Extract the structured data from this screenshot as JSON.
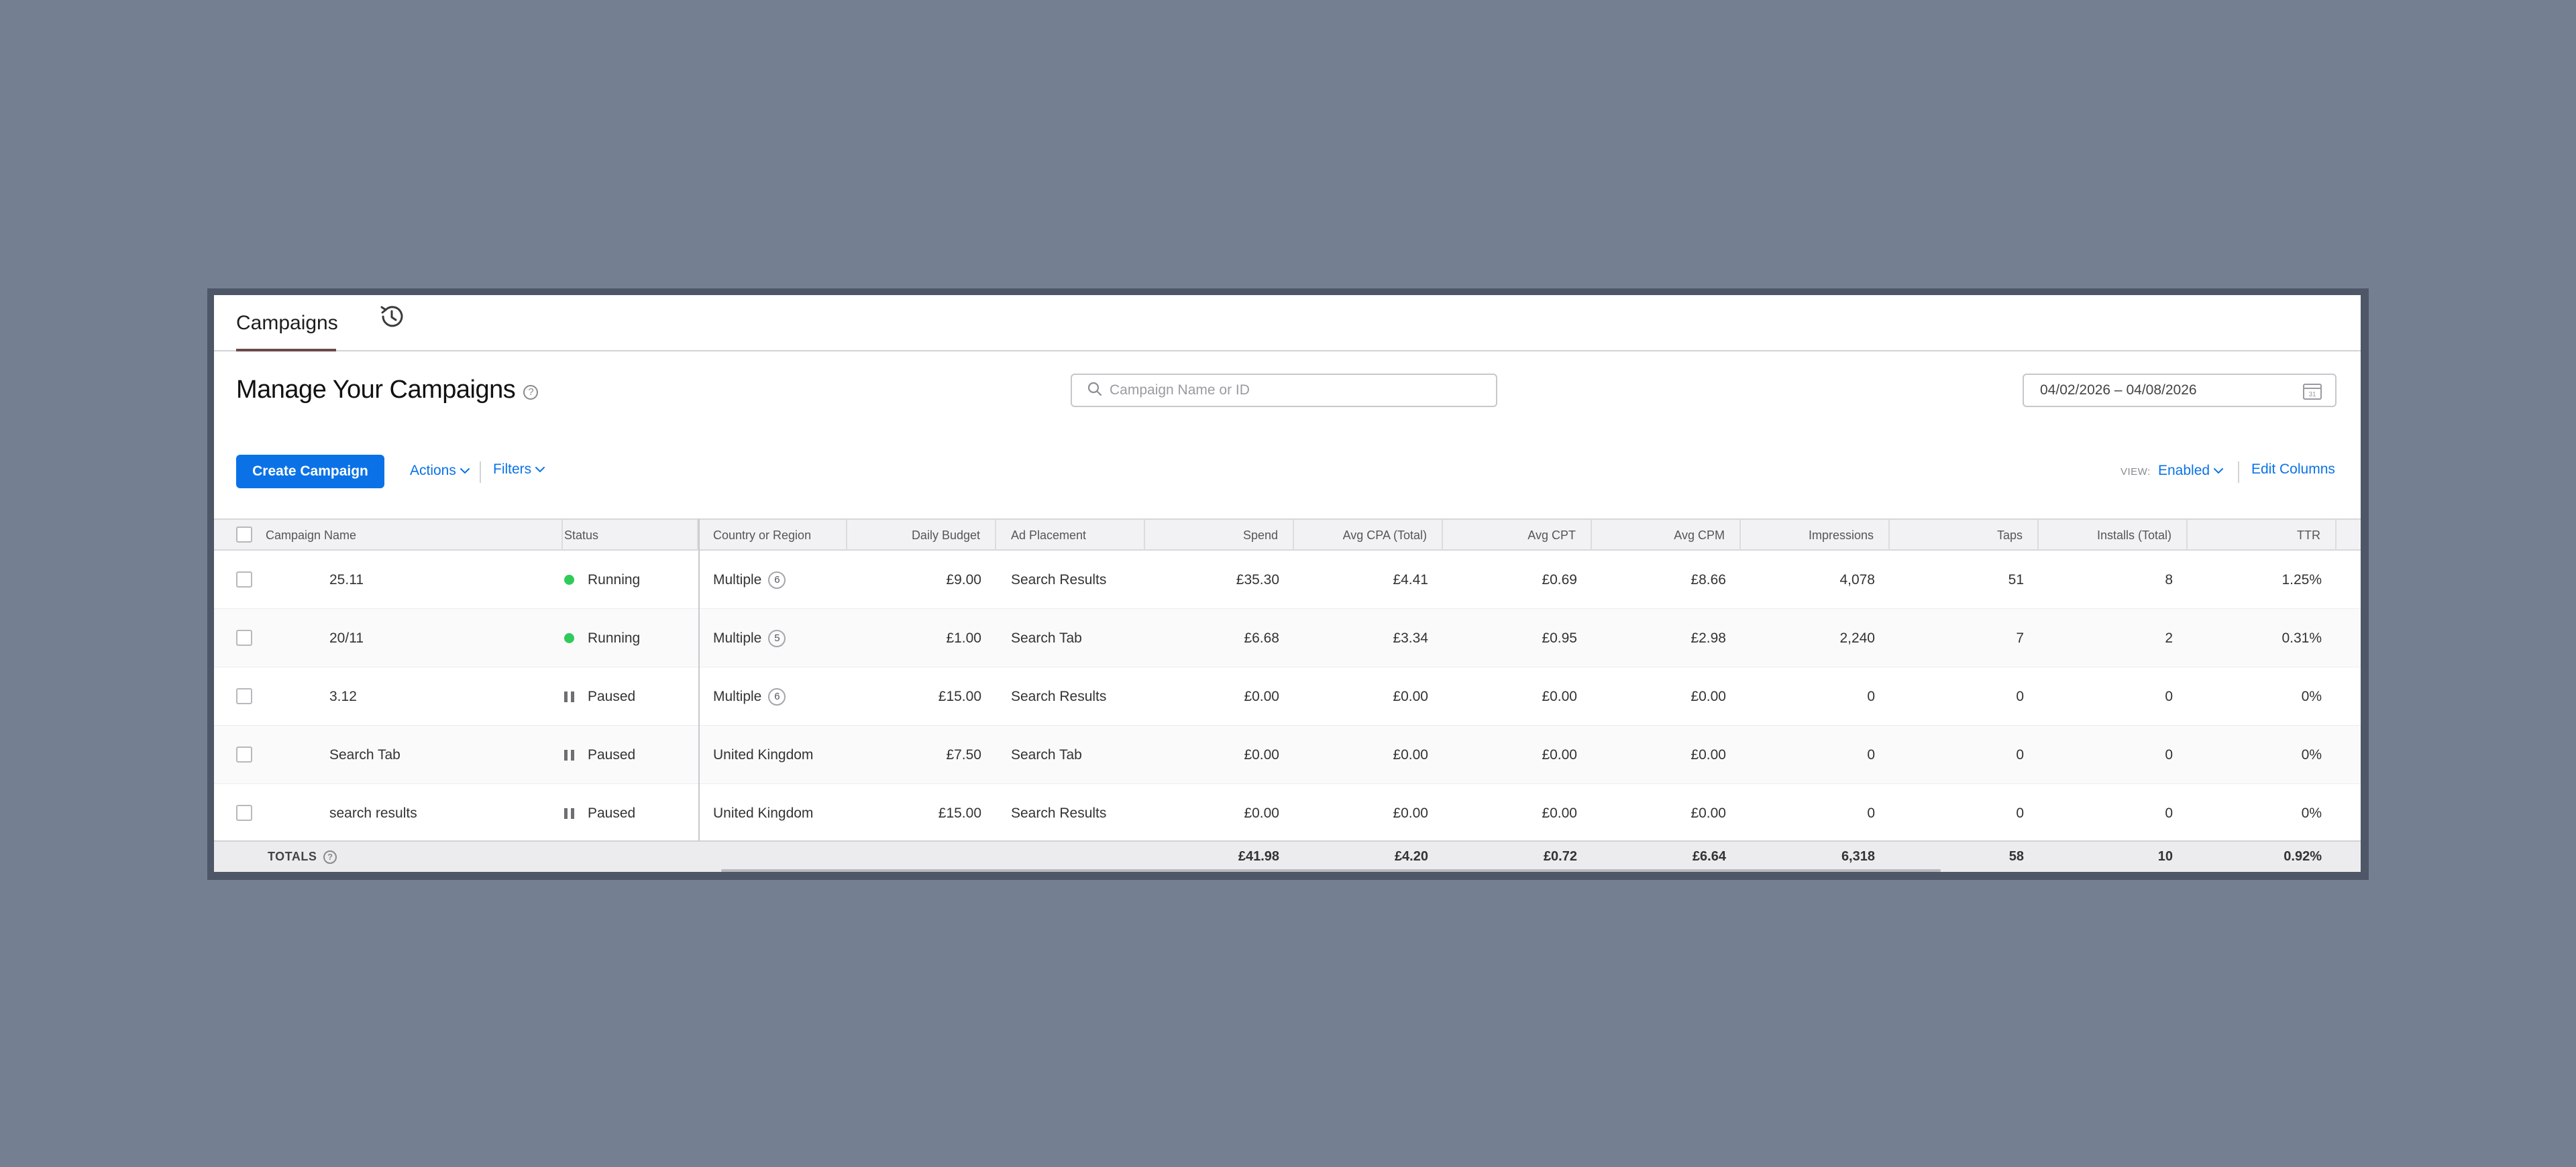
{
  "tabs": {
    "campaigns_label": "Campaigns"
  },
  "header": {
    "title": "Manage Your Campaigns",
    "help_glyph": "?"
  },
  "search": {
    "placeholder": "Campaign Name or ID"
  },
  "date_range": {
    "value": "04/02/2026 – 04/08/2026",
    "calendar_glyph": "31"
  },
  "toolbar": {
    "create_label": "Create Campaign",
    "actions_label": "Actions",
    "filters_label": "Filters",
    "view_label": "VIEW:",
    "view_value": "Enabled",
    "edit_columns_label": "Edit Columns"
  },
  "table": {
    "columns": [
      "Campaign Name",
      "Status",
      "Country or Region",
      "Daily Budget",
      "Ad Placement",
      "Spend",
      "Avg CPA (Total)",
      "Avg CPT",
      "Avg CPM",
      "Impressions",
      "Taps",
      "Installs (Total)",
      "TTR"
    ],
    "rows": [
      {
        "name": "25.11",
        "status": "Running",
        "country": "Multiple",
        "country_count": "6",
        "budget": "£9.00",
        "placement": "Search Results",
        "spend": "£35.30",
        "cpa": "£4.41",
        "cpt": "£0.69",
        "cpm": "£8.66",
        "impressions": "4,078",
        "taps": "51",
        "installs": "8",
        "ttr": "1.25%"
      },
      {
        "name": "20/11",
        "status": "Running",
        "country": "Multiple",
        "country_count": "5",
        "budget": "£1.00",
        "placement": "Search Tab",
        "spend": "£6.68",
        "cpa": "£3.34",
        "cpt": "£0.95",
        "cpm": "£2.98",
        "impressions": "2,240",
        "taps": "7",
        "installs": "2",
        "ttr": "0.31%"
      },
      {
        "name": "3.12",
        "status": "Paused",
        "country": "Multiple",
        "country_count": "6",
        "budget": "£15.00",
        "placement": "Search Results",
        "spend": "£0.00",
        "cpa": "£0.00",
        "cpt": "£0.00",
        "cpm": "£0.00",
        "impressions": "0",
        "taps": "0",
        "installs": "0",
        "ttr": "0%"
      },
      {
        "name": "Search Tab",
        "status": "Paused",
        "country": "United Kingdom",
        "country_count": "",
        "budget": "£7.50",
        "placement": "Search Tab",
        "spend": "£0.00",
        "cpa": "£0.00",
        "cpt": "£0.00",
        "cpm": "£0.00",
        "impressions": "0",
        "taps": "0",
        "installs": "0",
        "ttr": "0%"
      },
      {
        "name": "search results",
        "status": "Paused",
        "country": "United Kingdom",
        "country_count": "",
        "budget": "£15.00",
        "placement": "Search Results",
        "spend": "£0.00",
        "cpa": "£0.00",
        "cpt": "£0.00",
        "cpm": "£0.00",
        "impressions": "0",
        "taps": "0",
        "installs": "0",
        "ttr": "0%"
      }
    ],
    "totals": {
      "label": "TOTALS",
      "spend": "£41.98",
      "cpa": "£4.20",
      "cpt": "£0.72",
      "cpm": "£6.64",
      "impressions": "6,318",
      "taps": "58",
      "installs": "10",
      "ttr": "0.92%"
    }
  },
  "colors": {
    "accent": "#0a72e6",
    "running": "#2fcb59",
    "paused": "#6e6e73",
    "backdrop": "#747f92"
  },
  "icons": {
    "history": "history-icon",
    "search": "search-icon",
    "calendar": "calendar-icon",
    "help": "help-icon",
    "chevron": "chevron-down-icon",
    "running": "status-running-dot",
    "paused": "pause-icon"
  }
}
